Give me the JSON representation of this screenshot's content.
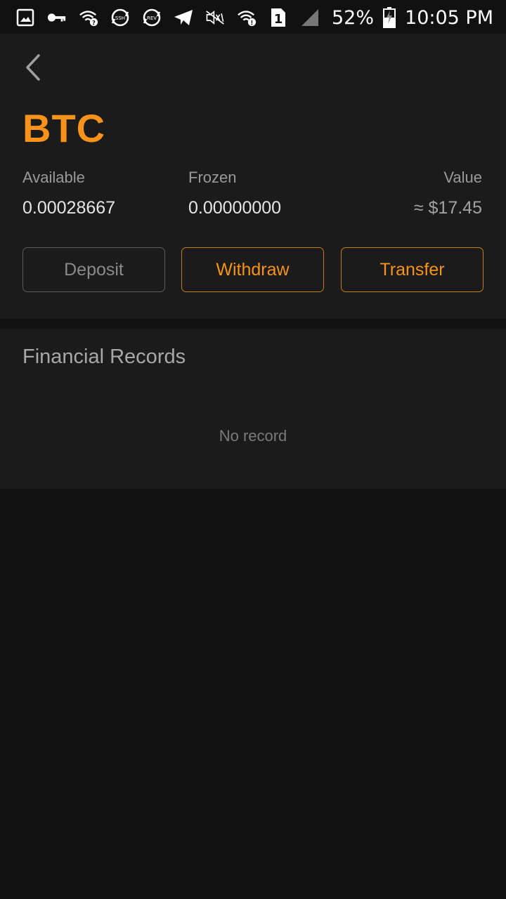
{
  "status_bar": {
    "battery": "52%",
    "time": "10:05 PM",
    "icons": [
      "image-icon",
      "key-icon",
      "wifi-question-icon",
      "ssh-icon",
      "rev-icon",
      "telegram-icon",
      "mute-icon",
      "wifi-alert-icon",
      "sim-1-icon",
      "signal-icon",
      "battery-charging-icon"
    ],
    "ssh_text": "SSH",
    "rev_text": "REV",
    "sim_text": "1"
  },
  "header": {
    "back_icon": "chevron-left-icon",
    "coin": "BTC"
  },
  "balances": {
    "available_label": "Available",
    "available_value": "0.00028667",
    "frozen_label": "Frozen",
    "frozen_value": "0.00000000",
    "value_label": "Value",
    "value_value": "≈ $17.45"
  },
  "actions": {
    "deposit": "Deposit",
    "withdraw": "Withdraw",
    "transfer": "Transfer"
  },
  "records": {
    "title": "Financial Records",
    "empty": "No record"
  },
  "colors": {
    "accent": "#f7931a",
    "background": "#121212",
    "card": "#1b1b1b"
  }
}
